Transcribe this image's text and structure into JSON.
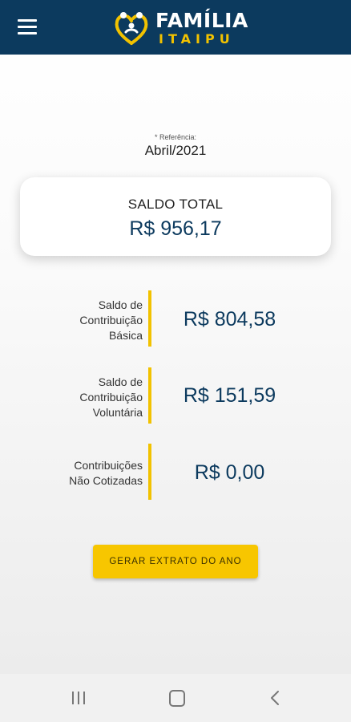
{
  "header": {
    "logo_word": "FAMÍLIA",
    "logo_sub": "ITAIPU",
    "menu_icon": "hamburger-menu-icon",
    "colors": {
      "bar": "#0c3a5e",
      "accent": "#f2c200"
    }
  },
  "reference": {
    "label": "* Referência:",
    "value": "Abril/2021"
  },
  "saldo_total": {
    "title": "SALDO TOTAL",
    "value": "R$ 956,17"
  },
  "rows": [
    {
      "label": [
        "Saldo de",
        "Contribuição",
        "Básica"
      ],
      "value": "R$ 804,58"
    },
    {
      "label": [
        "Saldo de",
        "Contribuição",
        "Voluntária"
      ],
      "value": "R$ 151,59"
    },
    {
      "label": [
        "Contribuições",
        "Não Cotizadas"
      ],
      "value": "R$ 0,00"
    }
  ],
  "actions": {
    "extrato_label": "GERAR EXTRATO DO ANO"
  },
  "system_nav": {
    "recent": "recent-apps-icon",
    "home": "home-icon",
    "back": "back-icon"
  }
}
